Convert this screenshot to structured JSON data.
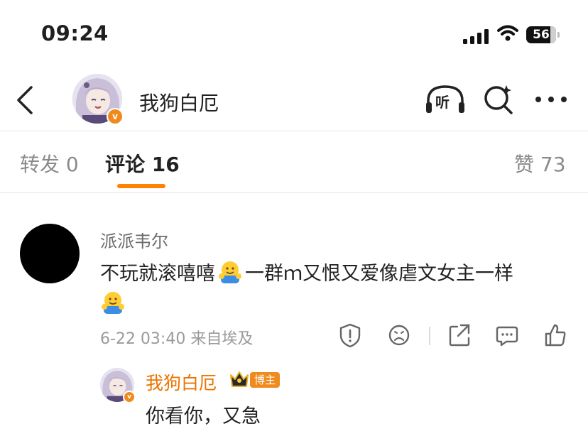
{
  "status_bar": {
    "time": "09:24",
    "battery": "56"
  },
  "nav": {
    "title": "我狗白厄",
    "verified_badge": "v",
    "listen_label": "听",
    "icons": [
      "back-arrow-icon",
      "listen-headphones-icon",
      "search-icon",
      "more-icon"
    ]
  },
  "tabs": {
    "repost": {
      "label": "转发",
      "count": "0"
    },
    "comments": {
      "label": "评论",
      "count": "16"
    },
    "likes": {
      "label": "赞",
      "count": "73"
    }
  },
  "comment": {
    "username": "派派韦尔",
    "text_part1": "不玩就滚嘻嘻",
    "text_part2": "一群ｍ又恨又爱像虐文女主一样",
    "date": "6-22 03:40",
    "source": "来自埃及",
    "actions": [
      "report-icon",
      "dislike-icon",
      "share-icon",
      "comment-icon",
      "like-icon"
    ]
  },
  "reply": {
    "username": "我狗白厄",
    "badge": "博主",
    "text": "你看你，又急"
  },
  "colors": {
    "accent": "#ff8200",
    "verified": "#f08a1c",
    "reply_name": "#eb7300",
    "muted_text": "#9a9a9a"
  }
}
